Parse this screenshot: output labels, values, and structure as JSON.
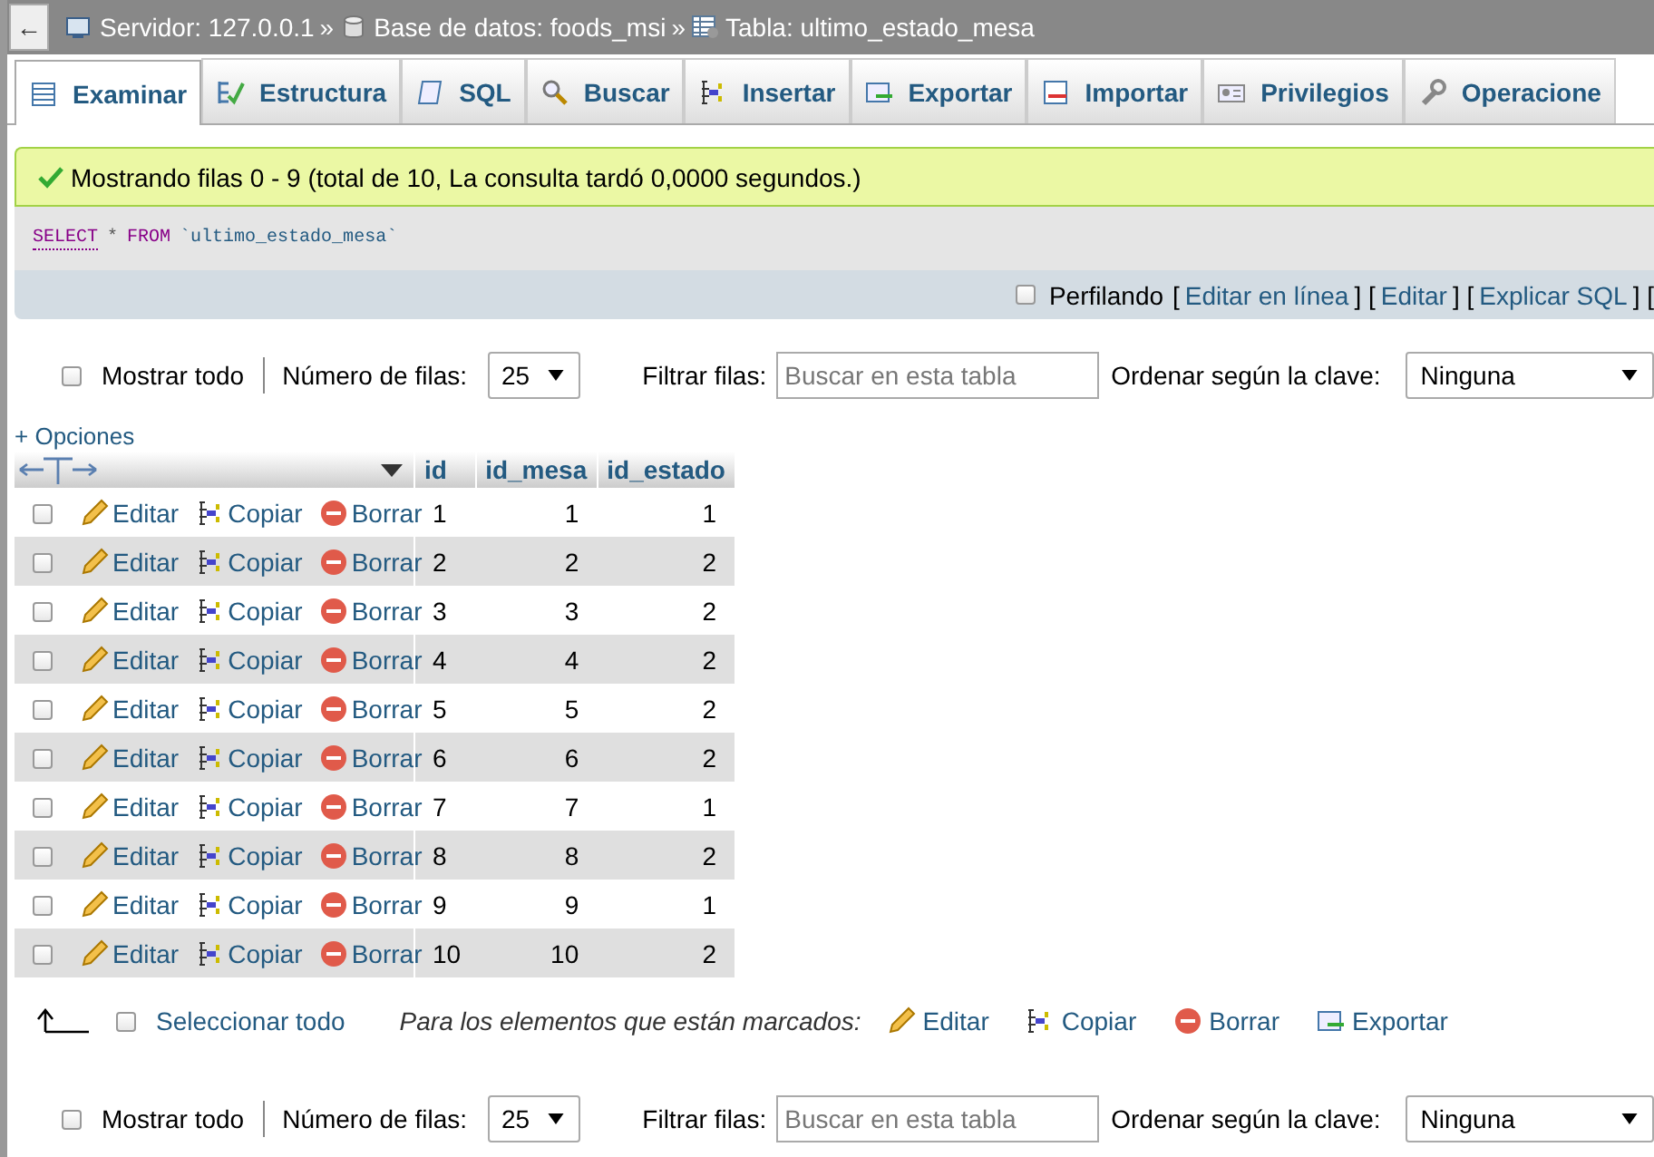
{
  "breadcrumb": {
    "back": "←",
    "items": [
      {
        "kind": "server",
        "text": "Servidor: 127.0.0.1",
        "after": "»"
      },
      {
        "kind": "database",
        "text": "Base de datos: foods_msi",
        "after": "»"
      },
      {
        "kind": "table",
        "text": "Tabla: ultimo_estado_mesa"
      }
    ]
  },
  "tabs": [
    {
      "kind": "browse",
      "label": "Examinar",
      "selected": true
    },
    {
      "kind": "structure",
      "label": "Estructura",
      "selected": false
    },
    {
      "kind": "sql",
      "label": "SQL",
      "selected": false
    },
    {
      "kind": "search",
      "label": "Buscar",
      "selected": false
    },
    {
      "kind": "insert",
      "label": "Insertar",
      "selected": false
    },
    {
      "kind": "export",
      "label": "Exportar",
      "selected": false
    },
    {
      "kind": "import",
      "label": "Importar",
      "selected": false
    },
    {
      "kind": "privileges",
      "label": "Privilegios",
      "selected": false
    },
    {
      "kind": "operations",
      "label": "Operacione",
      "selected": false
    }
  ],
  "message": "Mostrando filas 0 - 9 (total de 10, La consulta tardó 0,0000 segundos.)",
  "sql": {
    "tokens": [
      {
        "kind": "keyword",
        "text": "SELECT"
      },
      {
        "kind": "plain",
        "text": "*"
      },
      {
        "kind": "keyword",
        "text": "FROM"
      },
      {
        "kind": "name",
        "text": "`ultimo_estado_mesa`"
      }
    ]
  },
  "profiling": {
    "checked": false,
    "label": "Perfilando",
    "parts": [
      {
        "kind": "text",
        "text": "["
      },
      {
        "kind": "link",
        "text": "Editar en línea"
      },
      {
        "kind": "text",
        "text": "] ["
      },
      {
        "kind": "link",
        "text": "Editar"
      },
      {
        "kind": "text",
        "text": "] ["
      },
      {
        "kind": "link",
        "text": "Explicar SQL"
      },
      {
        "kind": "text",
        "text": "] ["
      }
    ]
  },
  "nav_top": {
    "show_all": {
      "label": "Mostrar todo",
      "checked": false
    },
    "rows_label": "Número de filas:",
    "rows_value": "25",
    "filter_label": "Filtrar filas:",
    "filter_placeholder": "Buscar en esta tabla",
    "sort_label": "Ordenar según la clave:",
    "sort_value": "Ninguna"
  },
  "options": "+ Opciones",
  "table": {
    "columns": [
      "id",
      "id_mesa",
      "id_estado"
    ],
    "rows": [
      {
        "checked": false,
        "edit": "Editar",
        "copy": "Copiar",
        "delete": "Borrar",
        "cells": [
          "1",
          "1",
          "1"
        ]
      },
      {
        "checked": false,
        "edit": "Editar",
        "copy": "Copiar",
        "delete": "Borrar",
        "cells": [
          "2",
          "2",
          "2"
        ]
      },
      {
        "checked": false,
        "edit": "Editar",
        "copy": "Copiar",
        "delete": "Borrar",
        "cells": [
          "3",
          "3",
          "2"
        ]
      },
      {
        "checked": false,
        "edit": "Editar",
        "copy": "Copiar",
        "delete": "Borrar",
        "cells": [
          "4",
          "4",
          "2"
        ]
      },
      {
        "checked": false,
        "edit": "Editar",
        "copy": "Copiar",
        "delete": "Borrar",
        "cells": [
          "5",
          "5",
          "2"
        ]
      },
      {
        "checked": false,
        "edit": "Editar",
        "copy": "Copiar",
        "delete": "Borrar",
        "cells": [
          "6",
          "6",
          "2"
        ]
      },
      {
        "checked": false,
        "edit": "Editar",
        "copy": "Copiar",
        "delete": "Borrar",
        "cells": [
          "7",
          "7",
          "1"
        ]
      },
      {
        "checked": false,
        "edit": "Editar",
        "copy": "Copiar",
        "delete": "Borrar",
        "cells": [
          "8",
          "8",
          "2"
        ]
      },
      {
        "checked": false,
        "edit": "Editar",
        "copy": "Copiar",
        "delete": "Borrar",
        "cells": [
          "9",
          "9",
          "1"
        ]
      },
      {
        "checked": false,
        "edit": "Editar",
        "copy": "Copiar",
        "delete": "Borrar",
        "cells": [
          "10",
          "10",
          "2"
        ]
      }
    ]
  },
  "bulk": {
    "select_all": {
      "label": "Seleccionar todo",
      "checked": false
    },
    "marked_label": "Para los elementos que están marcados:",
    "actions": [
      {
        "kind": "edit",
        "label": "Editar"
      },
      {
        "kind": "copy",
        "label": "Copiar"
      },
      {
        "kind": "delete",
        "label": "Borrar"
      },
      {
        "kind": "export",
        "label": "Exportar"
      }
    ]
  },
  "nav_bottom": {
    "show_all": {
      "label": "Mostrar todo",
      "checked": false
    },
    "rows_label": "Número de filas:",
    "rows_value": "25",
    "filter_label": "Filtrar filas:",
    "filter_placeholder": "Buscar en esta tabla",
    "sort_label": "Ordenar según la clave:",
    "sort_value": "Ninguna"
  }
}
